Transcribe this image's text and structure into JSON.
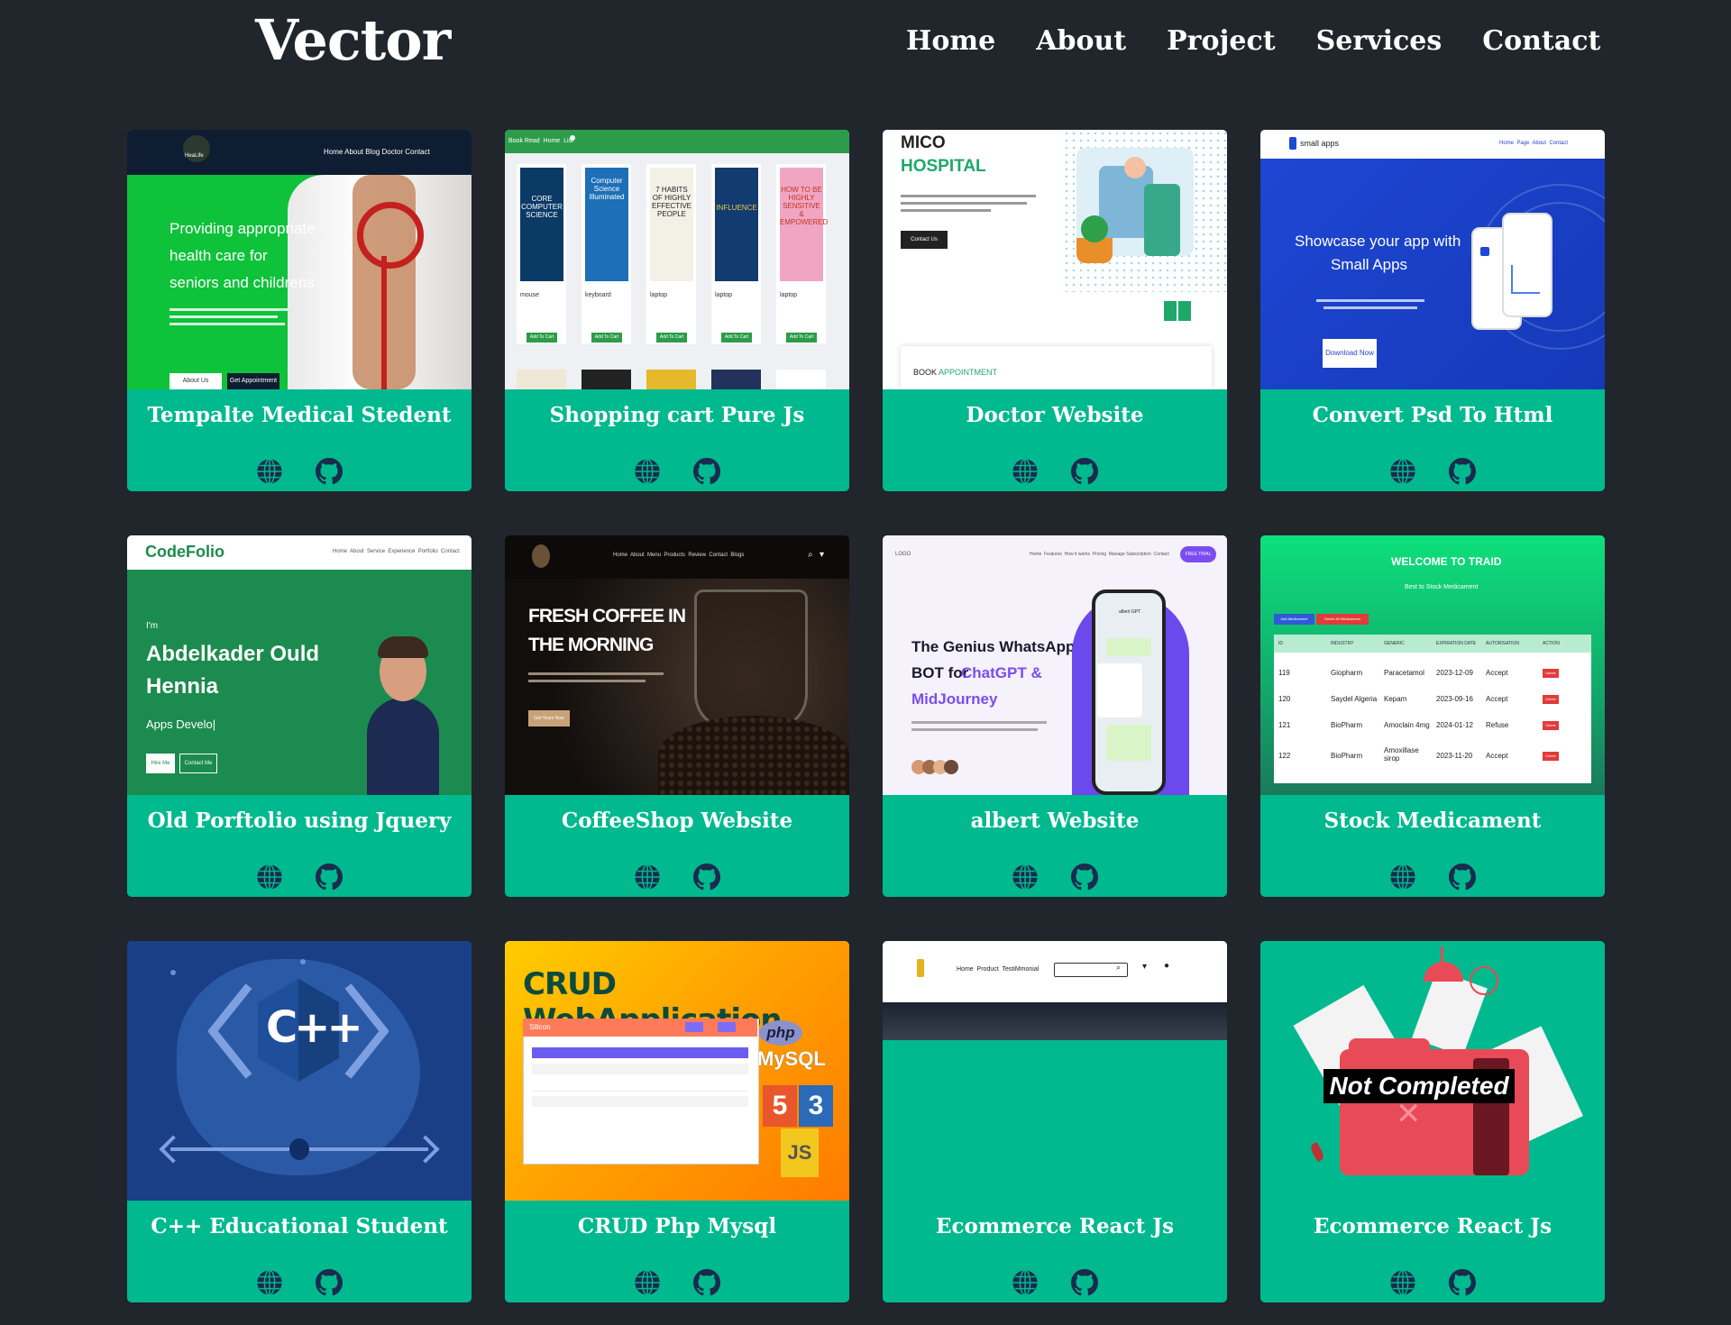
{
  "header": {
    "logo": "Vector",
    "nav": [
      "Home",
      "About",
      "Project",
      "Services",
      "Contact"
    ]
  },
  "colors": {
    "background": "#21252c",
    "card": "#00b98e",
    "icon": "#1b2a4e"
  },
  "projects": [
    {
      "title": "Tempalte Medical Stedent",
      "thumb": {
        "nav": "Home About Blog Doctor Contact",
        "logo": "HeaLife",
        "h1": "Providing appropriate",
        "h2": "health care for",
        "h3": "seniors and childrens",
        "b1": "About Us",
        "b2": "Get Appointment"
      },
      "icons": [
        "globe-icon",
        "github-icon"
      ]
    },
    {
      "title": "Shopping cart Pure Js",
      "thumb": {
        "nav": "Book Read  Home  List",
        "btn": "Add To Cart",
        "books": [
          {
            "cover": "CORE COMPUTER SCIENCE",
            "label": "mouse"
          },
          {
            "cover": "Computer Science Illuminated",
            "label": "keyboard"
          },
          {
            "cover": "7 HABITS OF HIGHLY EFFECTIVE PEOPLE",
            "label": "laptop"
          },
          {
            "cover": "INFLUENCE",
            "label": "laptop"
          },
          {
            "cover": "HOW TO BE HIGHLY SENSITIVE & EMPOWERED",
            "label": "laptop"
          }
        ]
      },
      "icons": [
        "globe-icon",
        "github-icon"
      ]
    },
    {
      "title": "Doctor Website",
      "thumb": {
        "brand1": "MICO",
        "brand2": "HOSPITAL",
        "btn": "Contact Us",
        "book": "BOOK",
        "appt": "APPOINTMENT"
      },
      "icons": [
        "globe-icon",
        "github-icon"
      ]
    },
    {
      "title": "Convert Psd To Html",
      "thumb": {
        "brand": "small apps",
        "nav": "Home  Page  About  Contact",
        "h1": "Showcase your app with",
        "h2": "Small Apps",
        "btn": "Download Now"
      },
      "icons": [
        "globe-icon",
        "github-icon"
      ]
    },
    {
      "title": "Old Porftolio using Jquery",
      "thumb": {
        "brand": "CodeFolio",
        "nav": "Home  About  Service  Experience  Portfolio  Contact",
        "pre": "I'm",
        "n1": "Abdelkader Ould",
        "n2": "Hennia",
        "role": "Apps Develo|",
        "b1": "Hire Me",
        "b2": "Contact Me"
      },
      "icons": [
        "globe-icon",
        "github-icon"
      ]
    },
    {
      "title": "CoffeeShop Website",
      "thumb": {
        "nav": "Home  About  Menu  Products  Review  Contact  Blogs",
        "h1": "FRESH COFFEE IN",
        "h2": "THE MORNING",
        "btn": "Get Yours Now"
      },
      "icons": [
        "globe-icon",
        "github-icon"
      ]
    },
    {
      "title": "albert Website",
      "thumb": {
        "logo": "LOGO",
        "nav": "Home  Features  How it works  Pricing  Manage Subscription  Contact",
        "trial": "FREE TRIAL",
        "h1": "The Genius WhatsApp",
        "h2": "BOT for",
        "h2b": "ChatGPT &",
        "h3": "MidJourney",
        "phone": "albert GPT"
      },
      "icons": [
        "globe-icon",
        "github-icon"
      ]
    },
    {
      "title": "Stock Medicament",
      "thumb": {
        "h1": "WELCOME TO TRAID",
        "h2": "Best to Stock Medicament",
        "b1": "Add Medicament",
        "b2": "Delete All Medicament",
        "cols": [
          "ID",
          "INDUSTRY",
          "GENERIC",
          "EXPIRATION DATE",
          "AUTORISATION",
          "ACTION"
        ],
        "rows": [
          [
            "119",
            "Giopharm",
            "Paracetamol",
            "2023-12-09",
            "Accept"
          ],
          [
            "120",
            "Saydel Algeria",
            "Kepam",
            "2023-09-16",
            "Accept"
          ],
          [
            "121",
            "BioPharm",
            "Amoclain 4mg",
            "2024-01-12",
            "Refuse"
          ],
          [
            "122",
            "BioPharm",
            "Amoxillase sirop",
            "2023-11-20",
            "Accept"
          ]
        ],
        "del": "Delete"
      },
      "icons": [
        "globe-icon",
        "github-icon"
      ]
    },
    {
      "title": "C++ Educational Student",
      "thumb": {
        "logo": "C++"
      },
      "icons": [
        "globe-icon",
        "github-icon"
      ]
    },
    {
      "title": "CRUD Php Mysql",
      "thumb": {
        "h1": "CRUD WebApplication",
        "brand": "Silicon",
        "php": "php",
        "mysql": "MySQL",
        "h5": "5",
        "c3": "3",
        "js": "JS"
      },
      "icons": [
        "globe-icon",
        "github-icon"
      ]
    },
    {
      "title": "Ecommerce React Js",
      "thumb": {
        "nav": "Home  Product  TestiMmonial"
      },
      "icons": [
        "globe-icon",
        "github-icon"
      ]
    },
    {
      "title": "Ecommerce React Js",
      "thumb": {
        "label": "Not Completed"
      },
      "icons": [
        "globe-icon",
        "github-icon"
      ]
    }
  ]
}
